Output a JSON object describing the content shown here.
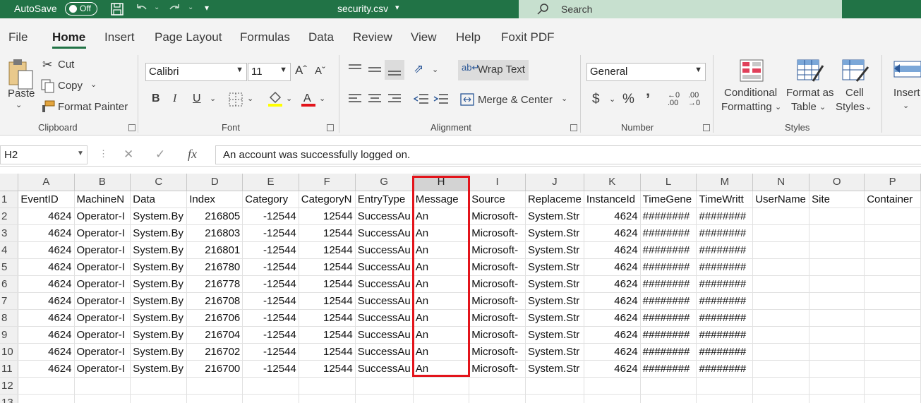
{
  "titlebar": {
    "autosave_label": "AutoSave",
    "autosave_state": "Off",
    "filename": "security.csv",
    "search_placeholder": "Search",
    "bg_color": "#217346"
  },
  "tabs": [
    "File",
    "Home",
    "Insert",
    "Page Layout",
    "Formulas",
    "Data",
    "Review",
    "View",
    "Help",
    "Foxit PDF"
  ],
  "active_tab": "Home",
  "ribbon": {
    "clipboard": {
      "paste": "Paste",
      "cut": "Cut",
      "copy": "Copy",
      "format_painter": "Format Painter",
      "label": "Clipboard"
    },
    "font": {
      "name": "Calibri",
      "size": "11",
      "bold": "B",
      "italic": "I",
      "underline": "U",
      "label": "Font"
    },
    "alignment": {
      "wrap_text": "Wrap Text",
      "merge_center": "Merge & Center",
      "label": "Alignment"
    },
    "number": {
      "format": "General",
      "currency": "$",
      "percent": "%",
      "comma": "’",
      "label": "Number"
    },
    "styles": {
      "conditional_1": "Conditional",
      "conditional_2": "Formatting",
      "format_as_1": "Format as",
      "format_as_2": "Table",
      "cell_1": "Cell",
      "cell_2": "Styles",
      "label": "Styles"
    },
    "cells": {
      "insert": "Insert"
    }
  },
  "formula_bar": {
    "name_box": "H2",
    "fx": "fx",
    "content": "An account was successfully logged on."
  },
  "grid": {
    "columns": [
      "A",
      "B",
      "C",
      "D",
      "E",
      "F",
      "G",
      "H",
      "I",
      "J",
      "K",
      "L",
      "M",
      "N",
      "O",
      "P"
    ],
    "selected_column": "H",
    "header_row": [
      "EventID",
      "MachineN",
      "Data",
      "Index",
      "Category",
      "CategoryN",
      "EntryType",
      "Message",
      "Source",
      "Replaceme",
      "InstanceId",
      "TimeGene",
      "TimeWritt",
      "UserName",
      "Site",
      "Container"
    ],
    "rows": [
      [
        "4624",
        "Operator-I",
        "System.By",
        "216805",
        "-12544",
        "12544",
        "SuccessAu",
        "An",
        "Microsoft-",
        "System.Str",
        "4624",
        "########",
        "########",
        "",
        "",
        ""
      ],
      [
        "4624",
        "Operator-I",
        "System.By",
        "216803",
        "-12544",
        "12544",
        "SuccessAu",
        "An",
        "Microsoft-",
        "System.Str",
        "4624",
        "########",
        "########",
        "",
        "",
        ""
      ],
      [
        "4624",
        "Operator-I",
        "System.By",
        "216801",
        "-12544",
        "12544",
        "SuccessAu",
        "An",
        "Microsoft-",
        "System.Str",
        "4624",
        "########",
        "########",
        "",
        "",
        ""
      ],
      [
        "4624",
        "Operator-I",
        "System.By",
        "216780",
        "-12544",
        "12544",
        "SuccessAu",
        "An",
        "Microsoft-",
        "System.Str",
        "4624",
        "########",
        "########",
        "",
        "",
        ""
      ],
      [
        "4624",
        "Operator-I",
        "System.By",
        "216778",
        "-12544",
        "12544",
        "SuccessAu",
        "An",
        "Microsoft-",
        "System.Str",
        "4624",
        "########",
        "########",
        "",
        "",
        ""
      ],
      [
        "4624",
        "Operator-I",
        "System.By",
        "216708",
        "-12544",
        "12544",
        "SuccessAu",
        "An",
        "Microsoft-",
        "System.Str",
        "4624",
        "########",
        "########",
        "",
        "",
        ""
      ],
      [
        "4624",
        "Operator-I",
        "System.By",
        "216706",
        "-12544",
        "12544",
        "SuccessAu",
        "An",
        "Microsoft-",
        "System.Str",
        "4624",
        "########",
        "########",
        "",
        "",
        ""
      ],
      [
        "4624",
        "Operator-I",
        "System.By",
        "216704",
        "-12544",
        "12544",
        "SuccessAu",
        "An",
        "Microsoft-",
        "System.Str",
        "4624",
        "########",
        "########",
        "",
        "",
        ""
      ],
      [
        "4624",
        "Operator-I",
        "System.By",
        "216702",
        "-12544",
        "12544",
        "SuccessAu",
        "An",
        "Microsoft-",
        "System.Str",
        "4624",
        "########",
        "########",
        "",
        "",
        ""
      ],
      [
        "4624",
        "Operator-I",
        "System.By",
        "216700",
        "-12544",
        "12544",
        "SuccessAu",
        "An",
        "Microsoft-",
        "System.Str",
        "4624",
        "########",
        "########",
        "",
        "",
        ""
      ],
      [
        "",
        "",
        "",
        "",
        "",
        "",
        "",
        "",
        "",
        "",
        "",
        "",
        "",
        "",
        "",
        ""
      ],
      [
        "",
        "",
        "",
        "",
        "",
        "",
        "",
        "",
        "",
        "",
        "",
        "",
        "",
        "",
        "",
        ""
      ]
    ],
    "numeric_columns": [
      0,
      3,
      4,
      5,
      10
    ],
    "highlight_color": "#e3141b"
  }
}
